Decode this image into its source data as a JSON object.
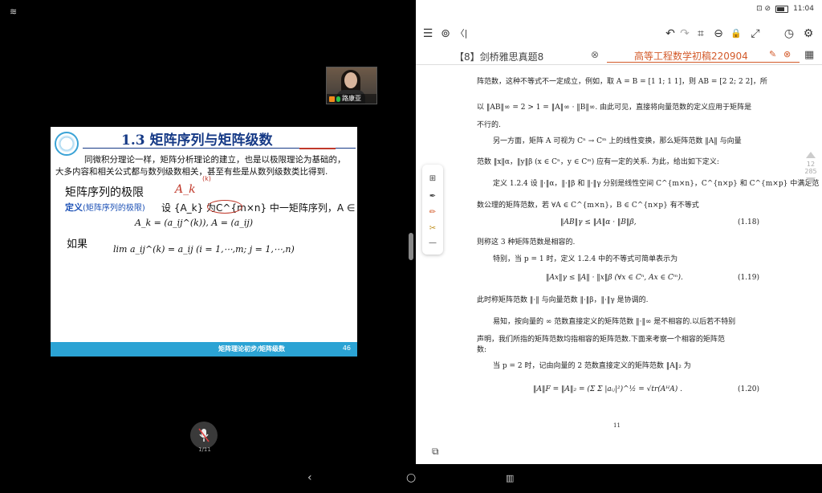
{
  "left": {
    "wifi": "≋",
    "video": {
      "name": "路康亚"
    },
    "slide": {
      "title": "1.3  矩阵序列与矩阵级数",
      "para1": "同微积分理论一样，矩阵分析理论的建立，也是以极限理论为基础的，",
      "para2": "大多内容和相关公式都与数列级数相关，甚至有些是从数列级数类比得到.",
      "heading": "矩阵序列的极限",
      "def_label": "定义",
      "def_paren": "(矩阵序列的极限)",
      "def_text": "设 {A_k} 为C^{m×n} 中一矩阵序列，A ∈ C^{m×n}，",
      "ak_text": "A_k = (a_ij^(k)), A = (a_ij)",
      "ruguo": "如果",
      "lim_text": "lim a_ij^(k) = a_ij    (i = 1,⋯,m; j = 1,⋯,n)",
      "red_a": "A_k",
      "red_sup": "(k)",
      "footer": "矩阵理论初步/矩阵级数",
      "footer_page": "46"
    },
    "mic_count": "1/11"
  },
  "right": {
    "status": {
      "time": "11:04",
      "icons": "⊡ ⊘"
    },
    "toolbar": {
      "menu": "☰",
      "layers": "⊚",
      "back": "〈|",
      "undo": "↶",
      "redo": "↷",
      "crop": "⌗",
      "lasso": "⊖",
      "lock": "🔒",
      "expand": "⤢",
      "clock": "◷",
      "settings": "⚙"
    },
    "tabs": {
      "tab1": "【8】剑桥雅思真题8",
      "tab1_close": "⊗",
      "tab2": "高等工程数学初稿220904",
      "tab2_edit": "✎",
      "tab2_close": "⊗",
      "grid": "▦"
    },
    "doc": {
      "l1": "阵范数，这种不等式不一定成立，例如，取 A = B = [1 1; 1 1]，则 AB = [2 2; 2 2]，所",
      "l2": "以 ‖AB‖∞ = 2 > 1 = ‖A‖∞ · ‖B‖∞. 由此可见，直接将向量范数的定义应用于矩阵是",
      "l3": "不行的.",
      "l4": "另一方面，矩阵 A 可视为 Cⁿ → Cᵐ 上的线性变换，那么矩阵范数 ‖A‖ 与向量",
      "l5": "范数 ‖x‖α，‖y‖β (x ∈ Cⁿ，y ∈ Cᵐ) 应有一定的关系. 为此，给出如下定义:",
      "l6": "定义 1.2.4  设 ‖·‖α，‖·‖β 和 ‖·‖γ 分别是线性空间 C^{m×n}，C^{n×p} 和 C^{m×p} 中满足范",
      "l7": "数公理的矩阵范数，若 ∀A ∈ C^{m×n}，B ∈ C^{n×p} 有不等式",
      "eq118": "‖AB‖γ ≤ ‖A‖α · ‖B‖β,",
      "n118": "(1.18)",
      "l8": "则称这 3 种矩阵范数是相容的.",
      "l9": "特别，当 p = 1 时，定义 1.2.4 中的不等式可简单表示为",
      "eq119": "‖Ax‖γ ≤ ‖A‖ · ‖x‖β    (∀x ∈ Cⁿ, Ax ∈ Cᵐ).",
      "n119": "(1.19)",
      "l10": "此时称矩阵范数 ‖·‖ 与向量范数 ‖·‖β，‖·‖γ 是协调的.",
      "l11": "易知，按向量的 ∞ 范数直接定义的矩阵范数 ‖·‖∞ 是不相容的.以后若不特别",
      "l12": "声明，我们所指的矩阵范数均指相容的矩阵范数.下面来考察一个相容的矩阵范",
      "l13": "数:",
      "l14": "当 p = 2 时，记由向量的 2 范数直接定义的矩阵范数 ‖A‖₂ 为",
      "eq120": "‖A‖F = ‖A‖₂ = (Σ Σ |aᵢⱼ|²)^½ = √tr(AᴴA) .",
      "n120": "(1.20)",
      "page": "11"
    },
    "scroll": {
      "current": "12",
      "total": "285"
    },
    "float_tools": [
      "⊞",
      "✒",
      "✏",
      "✂",
      "—"
    ],
    "bottom_icon": "⧉"
  },
  "nav": {
    "back": "‹",
    "home": "○",
    "recent": "▥"
  }
}
